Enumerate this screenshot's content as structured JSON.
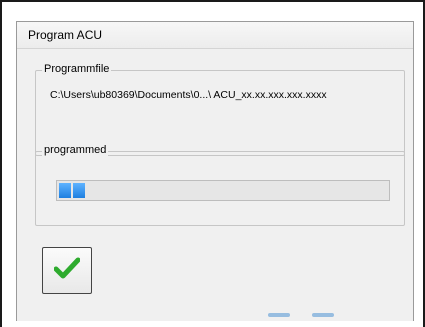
{
  "window": {
    "title": "Program ACU"
  },
  "file_group": {
    "legend": "Programmfile",
    "path": "C:\\Users\\ub80369\\Documents\\0...\\ ACU_xx.xx.xxx.xxx.xxxx"
  },
  "progress_group": {
    "legend": "programmed",
    "progress_fraction": 0.08
  },
  "ok_button": {
    "icon": "checkmark-icon",
    "icon_color": "#2eab2e"
  }
}
